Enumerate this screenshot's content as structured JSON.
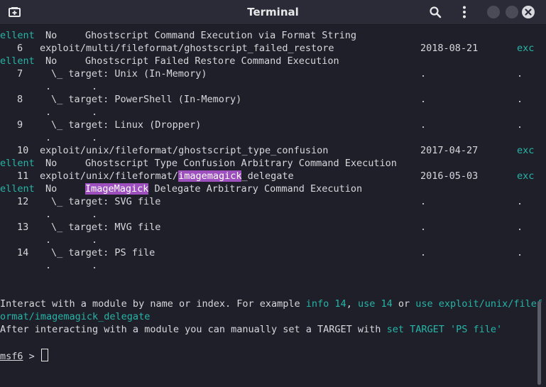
{
  "window": {
    "title": "Terminal",
    "icons": {
      "new_tab": "new-tab-icon",
      "search": "search-icon",
      "menu": "kebab-menu-icon",
      "minimize": "minimize-icon",
      "maximize": "maximize-icon",
      "close": "close-icon"
    }
  },
  "colors": {
    "background": "#1e1f29",
    "text": "#d7d8dc",
    "accent": "#27b5a7",
    "highlight": "#9c4fbd"
  },
  "terminal": {
    "rows": [
      {
        "c1": "ellent",
        "c2": "No",
        "c3": "Ghostscript Command Execution via Format String"
      },
      {
        "idx": "6",
        "module": "exploit/multi/fileformat/ghostscript_failed_restore",
        "date": "2018-08-21",
        "rank": "exc"
      },
      {
        "c1": "ellent",
        "c2": "No",
        "c3": "Ghostscript Failed Restore Command Execution"
      },
      {
        "idx": "7",
        "target": "\\_ target: Unix (In-Memory)",
        "dot1": ".",
        "dot2": "."
      },
      {
        "dots": ".       ."
      },
      {
        "idx": "8",
        "target": "\\_ target: PowerShell (In-Memory)",
        "dot1": ".",
        "dot2": "."
      },
      {
        "dots": ".       ."
      },
      {
        "idx": "9",
        "target": "\\_ target: Linux (Dropper)",
        "dot1": ".",
        "dot2": "."
      },
      {
        "dots": ".       ."
      },
      {
        "idx": "10",
        "module": "exploit/unix/fileformat/ghostscript_type_confusion",
        "date": "2017-04-27",
        "rank": "exc"
      },
      {
        "c1": "ellent",
        "c2": "No",
        "c3": "Ghostscript Type Confusion Arbitrary Command Execution"
      },
      {
        "idx": "11",
        "module_pre": "exploit/unix/fileformat/",
        "module_hl": "imagemagick",
        "module_post": "_delegate",
        "date": "2016-05-03",
        "rank": "exc"
      },
      {
        "c1": "ellent",
        "c2": "No",
        "c3_hl": "ImageMagick",
        "c3_rest": " Delegate Arbitrary Command Execution"
      },
      {
        "idx": "12",
        "target": "\\_ target: SVG file",
        "dot1": ".",
        "dot2": "."
      },
      {
        "dots": ".       ."
      },
      {
        "idx": "13",
        "target": "\\_ target: MVG file",
        "dot1": ".",
        "dot2": "."
      },
      {
        "dots": ".       ."
      },
      {
        "idx": "14",
        "target": "\\_ target: PS file",
        "dot1": ".",
        "dot2": "."
      },
      {
        "dots": ".       ."
      }
    ],
    "help1": {
      "a": "Interact with a module by name or index. For example ",
      "b": "info 14",
      "c": ", ",
      "d": "use 14",
      "e": " or ",
      "f": "use exploit/unix/filef"
    },
    "help2": {
      "a": "ormat/imagemagick_delegate"
    },
    "help3": {
      "a": "After interacting with a module you can manually set a TARGET with ",
      "b": "set TARGET 'PS file'"
    },
    "prompt": {
      "name": "msf6",
      "symbol": " > "
    }
  }
}
